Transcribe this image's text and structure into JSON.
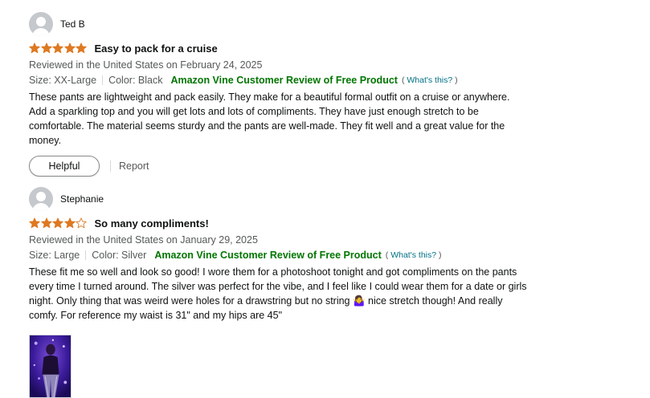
{
  "reviews": [
    {
      "reviewer": "Ted B",
      "rating": 5,
      "title": "Easy to pack for a cruise",
      "meta": "Reviewed in the United States on February 24, 2025",
      "size": "Size: XX-Large",
      "color": "Color: Black",
      "vine": "Amazon Vine Customer Review of Free Product",
      "whats_open": "(",
      "whats_link": "What's this?",
      "whats_close": ")",
      "body": "These pants are lightweight and pack easily. They make for a beautiful formal outfit on a cruise or anywhere. Add a sparkling top and you will get lots and lots of compliments. They have just enough stretch to be comfortable. The material seems sturdy and the pants are well-made. They fit well and a great value for the money.",
      "helpful": "Helpful",
      "report": "Report"
    },
    {
      "reviewer": "Stephanie",
      "rating": 4,
      "title": "So many compliments!",
      "meta": "Reviewed in the United States on January 29, 2025",
      "size": "Size: Large",
      "color": "Color: Silver",
      "vine": "Amazon Vine Customer Review of Free Product",
      "whats_open": "(",
      "whats_link": "What's this?",
      "whats_close": ")",
      "body": "These fit me so well and look so good! I wore them for a photoshoot tonight and got compliments on the pants every time I turned around. The silver was perfect for the vibe, and I feel like I could wear them for a date or girls night. Only thing that was weird were holes for a drawstring but no string 🤷‍♀️ nice stretch though! And really comfy. For reference my waist is 31\" and my hips are 45\""
    }
  ],
  "colors": {
    "star": "#de7921",
    "vine": "#007600",
    "link": "#007185",
    "muted": "#565959"
  }
}
